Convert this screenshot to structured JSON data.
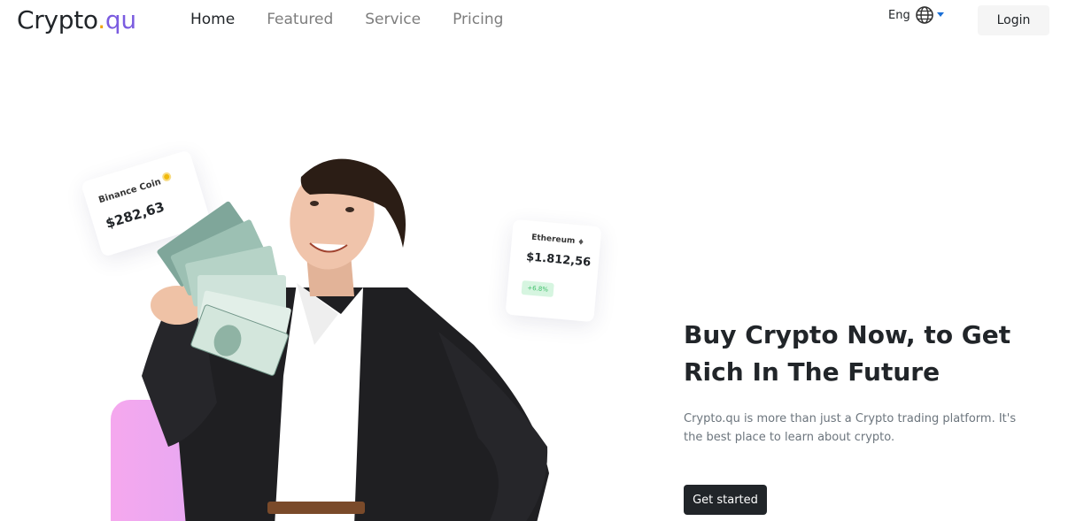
{
  "brand": {
    "name_main": "Crypto",
    "name_dot": ".",
    "name_accent": "qu",
    "accent_color": "#7b5ce0",
    "dot_color": "#f0a300"
  },
  "nav": {
    "items": [
      "Home",
      "Featured",
      "Service",
      "Pricing"
    ],
    "active": "Home"
  },
  "header": {
    "language_label": "Eng",
    "language_icon": "globe-icon",
    "login_label": "Login"
  },
  "cards": {
    "binance": {
      "name": "Binance Coin",
      "price": "$282,63",
      "icon": "coin-icon"
    },
    "ethereum": {
      "name": "Ethereum",
      "price": "$1.812,56",
      "icon": "ethereum-icon",
      "change": "+6.8%",
      "change_color": "#3fbf6a"
    }
  },
  "hero": {
    "title": "Buy Crypto Now, to Get Rich In The Future",
    "description": "Crypto.qu is more than just a Crypto trading platform. It's the best place to learn about crypto.",
    "cta_label": "Get started"
  }
}
